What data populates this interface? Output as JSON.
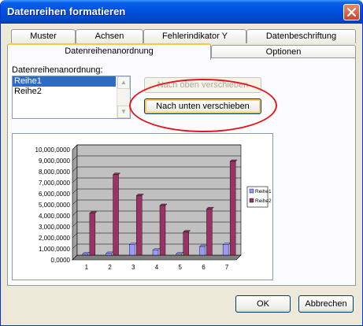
{
  "window": {
    "title": "Datenreihen formatieren"
  },
  "tabs": {
    "row1": [
      "Muster",
      "Achsen",
      "Fehlerindikator Y",
      "Datenbeschriftung"
    ],
    "row2": [
      "Datenreihenanordnung",
      "Optionen"
    ],
    "active": "Datenreihenanordnung"
  },
  "order": {
    "label": "Datenreihenanordnung:",
    "items": [
      "Reihe1",
      "Reihe2"
    ],
    "selected": "Reihe1",
    "move_up_label": "Nach oben verschieben",
    "move_down_label": "Nach unten verschieben"
  },
  "chart_data": {
    "type": "bar",
    "categories": [
      "1",
      "2",
      "3",
      "4",
      "5",
      "6",
      "7"
    ],
    "series": [
      {
        "name": "Reihe1",
        "color": "#9999ff",
        "values": [
          0.12,
          0.15,
          0.95,
          0.45,
          0.12,
          0.78,
          0.95
        ]
      },
      {
        "name": "Reihe2",
        "color": "#993366",
        "values": [
          3.8,
          7.3,
          5.4,
          4.5,
          2.1,
          4.2,
          8.5
        ]
      }
    ],
    "ylim": [
      0,
      10
    ],
    "yticks": [
      "0,0000",
      "1,000,0000",
      "2,000,0000",
      "3,000,0000",
      "4,000,0000",
      "5,000,0000",
      "6,000,0000",
      "7,000,0000",
      "8,000,0000",
      "9,000,0000",
      "10,000,0000"
    ],
    "plot_background": "#c0c0c0",
    "grid": true,
    "legend": "right"
  },
  "buttons": {
    "ok": "OK",
    "cancel": "Abbrechen"
  },
  "annotation": {
    "highlight_color": "#e5161b"
  }
}
